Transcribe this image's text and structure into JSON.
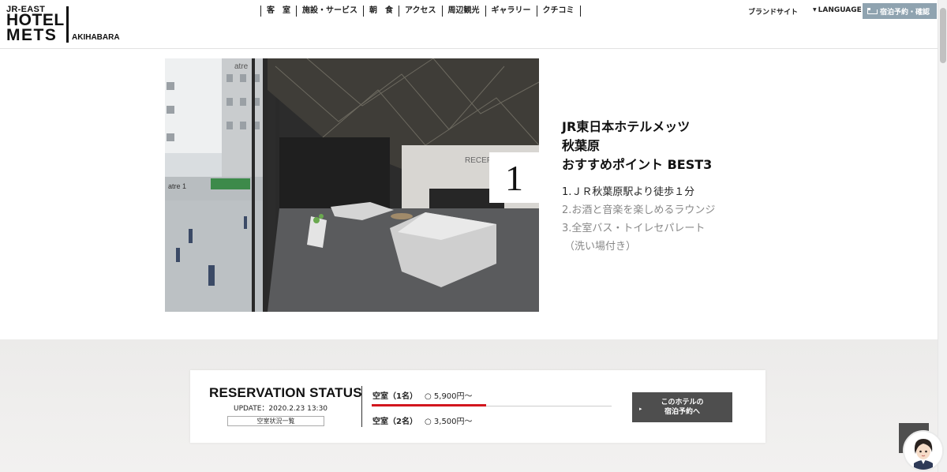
{
  "header": {
    "logo": {
      "line1": "JR-EAST",
      "line2": "HOTEL",
      "line3": "METS",
      "area": "AKIHABARA"
    },
    "nav": [
      "客　室",
      "施設・サービス",
      "朝　食",
      "アクセス",
      "周辺観光",
      "ギャラリー",
      "クチコミ"
    ],
    "brand_site": "ブランドサイト",
    "language": "LANGUAGE",
    "reserve_button": "宿泊予約・確認"
  },
  "feature": {
    "badge_number": "1",
    "title_lines": [
      "JR東日本ホテルメッツ",
      "秋葉原",
      "おすすめポイント BEST3"
    ],
    "points": [
      "1.ＪＲ秋葉原駅より徒歩１分",
      "2.お酒と音楽を楽しめるラウンジ",
      "3.全室バス・トイレセパレート",
      "（洗い場付き）"
    ],
    "photo_sign_text": "atre",
    "photo_sign_text2": "atre 1",
    "photo_reception_text": "RECEPTIO"
  },
  "reservation": {
    "title": "RESERVATION STATUS",
    "update": "UPDATE：2020.2.23 13:30",
    "list_button": "空室状況一覧",
    "rooms": [
      {
        "label": "空室（1名）",
        "price": "○ 5,900円〜"
      },
      {
        "label": "空室（2名）",
        "price": "○ 3,500円〜"
      }
    ],
    "book_button_lines": [
      "このホテルの",
      "宿泊予約へ"
    ],
    "book_arrow": "▸"
  },
  "icons": {
    "scroll_top": "chevron-up-icon",
    "assistant": "assistant-avatar-icon",
    "bed": "bed-icon"
  },
  "colors": {
    "reserve_button_bg": "#8fa3b0",
    "book_button_bg": "#4e4e4e",
    "availability_bar": "#d2161e",
    "band_bg": "#eeedec"
  }
}
